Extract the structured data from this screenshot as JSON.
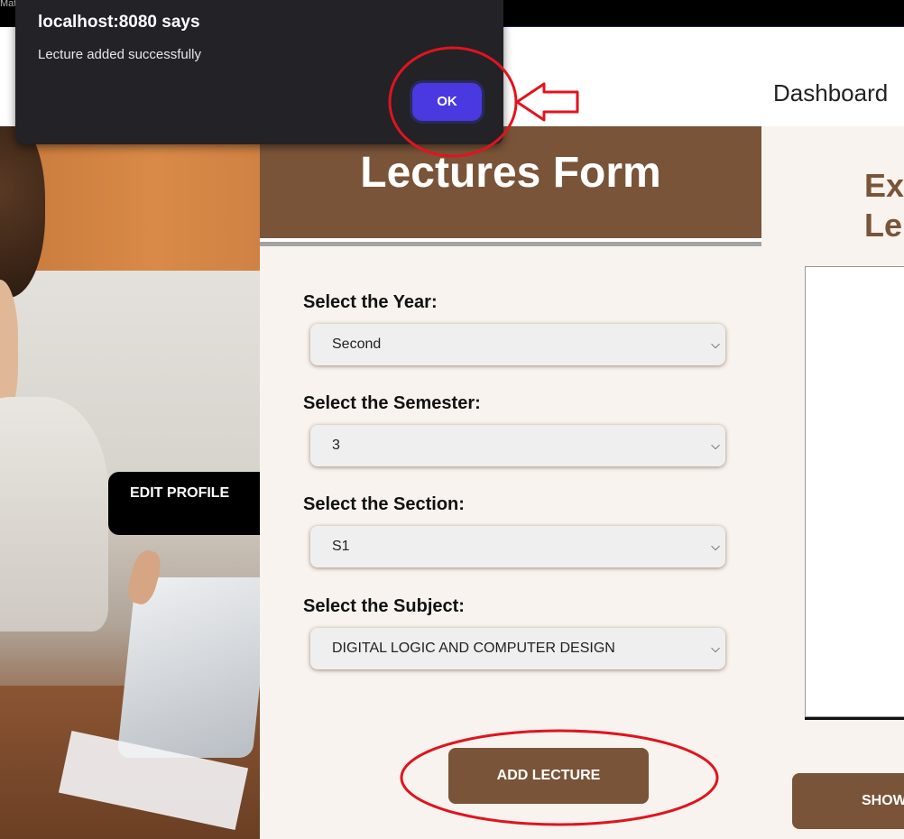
{
  "browser": {
    "tab_text": "Mat"
  },
  "header": {
    "dashboard_label": "Dashboard"
  },
  "sidebar": {
    "edit_profile_label": "EDIT PROFILE"
  },
  "form": {
    "title": "Lectures Form",
    "year": {
      "label": "Select the Year:",
      "value": "Second"
    },
    "semester": {
      "label": "Select the Semester:",
      "value": "3"
    },
    "section": {
      "label": "Select the Section:",
      "value": "S1"
    },
    "subject": {
      "label": "Select the Subject:",
      "value": "DIGITAL LOGIC AND COMPUTER DESIGN"
    },
    "add_button_label": "ADD LECTURE"
  },
  "right_panel": {
    "title_line1": "Ex",
    "title_line2": "Le",
    "show_button_label": "SHOW"
  },
  "alert": {
    "title": "localhost:8080 says",
    "message": "Lecture added successfully",
    "ok_label": "OK"
  },
  "colors": {
    "brown_accent": "#7a5438",
    "ok_button": "#4a39e0",
    "annotation_red": "#e0141e"
  },
  "icons": {
    "select_chevron": "chevron-down-icon",
    "annotation_arrow": "left-arrow-icon"
  }
}
